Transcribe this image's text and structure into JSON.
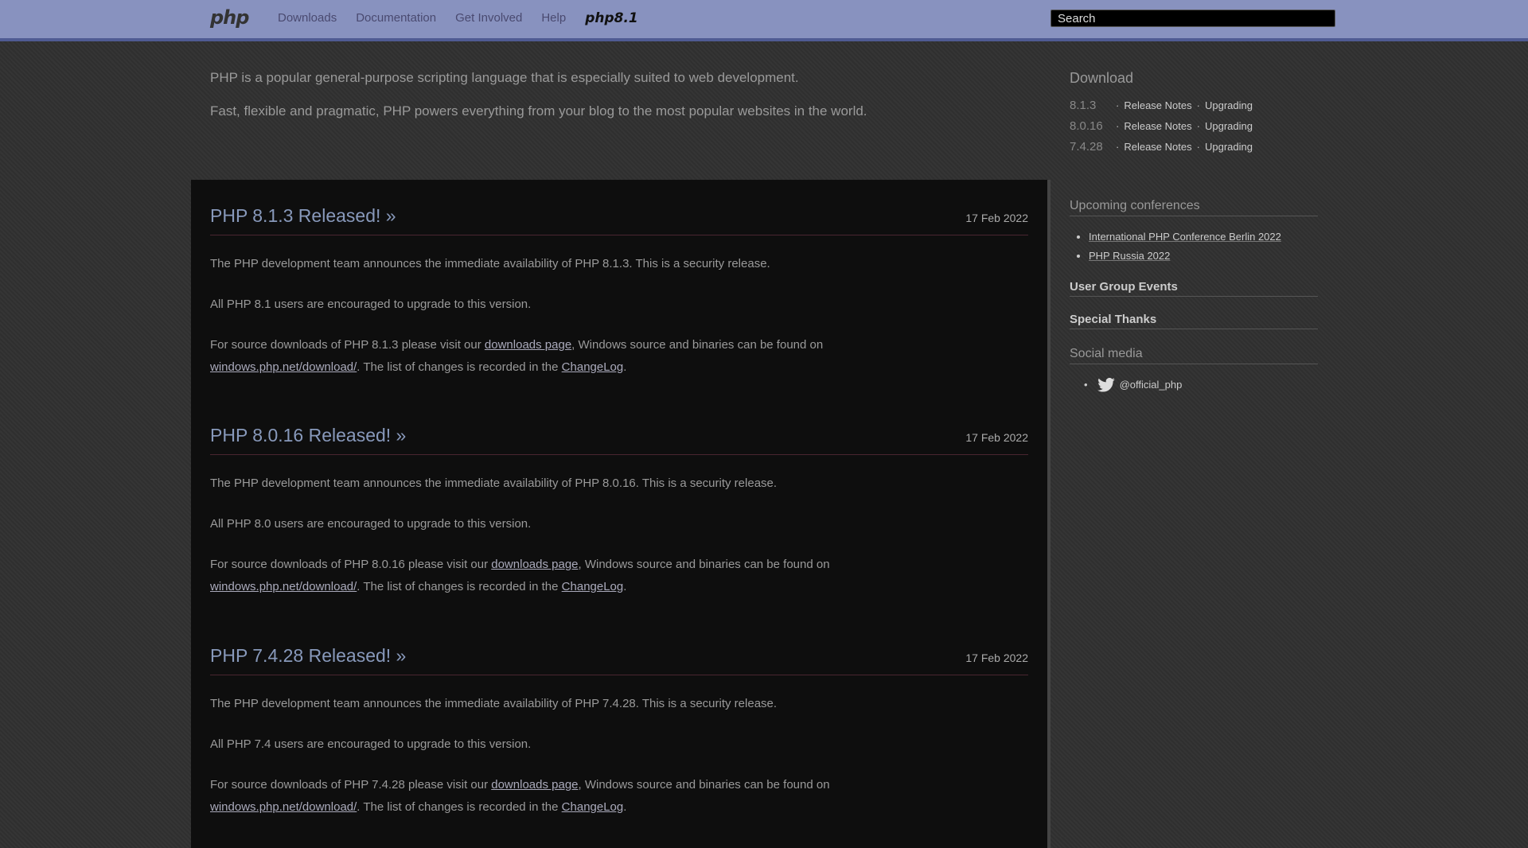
{
  "header": {
    "brand": "php",
    "nav": [
      "Downloads",
      "Documentation",
      "Get Involved",
      "Help"
    ],
    "promo": "php8.1",
    "search_placeholder": "Search"
  },
  "intro": {
    "line1": "PHP is a popular general-purpose scripting language that is especially suited to web development.",
    "line2": "Fast, flexible and pragmatic, PHP powers everything from your blog to the most popular websites in the world."
  },
  "download": {
    "title": "Download",
    "rows": [
      {
        "version": "8.1.3",
        "notes": "Release Notes",
        "upgrading": "Upgrading"
      },
      {
        "version": "8.0.16",
        "notes": "Release Notes",
        "upgrading": "Upgrading"
      },
      {
        "version": "7.4.28",
        "notes": "Release Notes",
        "upgrading": "Upgrading"
      }
    ]
  },
  "sidebar": {
    "conferences_title": "Upcoming conferences",
    "conferences": [
      "International PHP Conference Berlin 2022",
      "PHP Russia 2022"
    ],
    "user_groups_title": "User Group Events",
    "thanks_title": "Special Thanks",
    "social_title": "Social media",
    "social_handle": "@official_php"
  },
  "news": [
    {
      "title": "PHP 8.1.3 Released! »",
      "date": "17 Feb 2022",
      "p1": "The PHP development team announces the immediate availability of PHP 8.1.3. This is a security release.",
      "p2": "All PHP 8.1 users are encouraged to upgrade to this version.",
      "p3a": "For source downloads of PHP 8.1.3 please visit our ",
      "p3link1": "downloads page",
      "p3b": ", Windows source and binaries can be found on",
      "p3link2": "windows.php.net/download/",
      "p3c": ". The list of changes is recorded in the ",
      "p3link3": "ChangeLog",
      "p3d": "."
    },
    {
      "title": "PHP 8.0.16 Released! »",
      "date": "17 Feb 2022",
      "p1": "The PHP development team announces the immediate availability of PHP 8.0.16. This is a security release.",
      "p2": "All PHP 8.0 users are encouraged to upgrade to this version.",
      "p3a": "For source downloads of PHP 8.0.16 please visit our ",
      "p3link1": "downloads page",
      "p3b": ", Windows source and binaries can be found on",
      "p3link2": "windows.php.net/download/",
      "p3c": ". The list of changes is recorded in the ",
      "p3link3": "ChangeLog",
      "p3d": "."
    },
    {
      "title": "PHP 7.4.28 Released! »",
      "date": "17 Feb 2022",
      "p1": "The PHP development team announces the immediate availability of PHP 7.4.28. This is a security release.",
      "p2": "All PHP 7.4 users are encouraged to upgrade to this version.",
      "p3a": "For source downloads of PHP 7.4.28 please visit our ",
      "p3link1": "downloads page",
      "p3b": ", Windows source and binaries can be found on",
      "p3link2": "windows.php.net/download/",
      "p3c": ". The list of changes is recorded in the ",
      "p3link3": "ChangeLog",
      "p3d": "."
    }
  ]
}
